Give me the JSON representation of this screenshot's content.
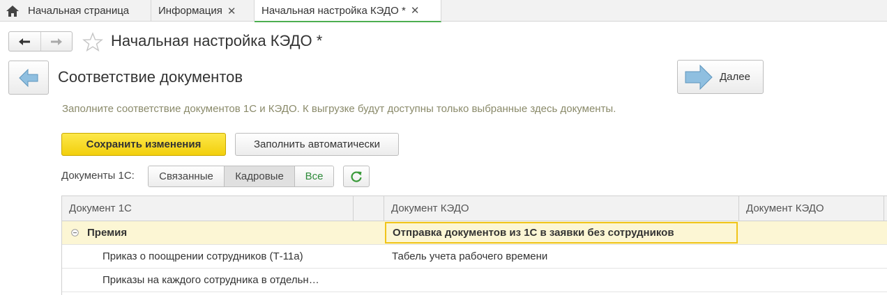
{
  "tabs": [
    {
      "label": "Начальная страница",
      "closable": false,
      "active": false
    },
    {
      "label": "Информация",
      "closable": true,
      "active": false
    },
    {
      "label": "Начальная настройка КЭДО *",
      "closable": true,
      "active": true
    }
  ],
  "window": {
    "title": "Начальная настройка КЭДО *"
  },
  "step": {
    "title": "Соответствие документов",
    "next_label": "Далее",
    "hint": "Заполните соответствие документов 1С и КЭДО. К выгрузке будут доступны только выбранные здесь документы."
  },
  "actions": {
    "save_label": "Сохранить изменения",
    "fill_label": "Заполнить автоматически"
  },
  "filter": {
    "label": "Документы 1С:",
    "options": [
      "Связанные",
      "Кадровые",
      "Все"
    ],
    "selected": "Все"
  },
  "table": {
    "columns": [
      "Документ 1С",
      "",
      "Документ КЭДО",
      "Документ КЭДО"
    ],
    "rows": [
      {
        "doc1c": "Премия",
        "kedo": "Отправка документов из 1С в заявки без сотрудников",
        "kedo2": "",
        "group": true
      },
      {
        "doc1c": "Приказ о поощрении сотрудников (Т-11а)",
        "kedo": "Табель учета рабочего времени",
        "kedo2": "",
        "group": false
      },
      {
        "doc1c": "Приказы на каждого сотрудника в отдельн…",
        "kedo": "",
        "kedo2": "",
        "group": false
      }
    ]
  },
  "colors": {
    "accent_yellow": "#f2cf0c",
    "active_tab_underline": "#4caf50",
    "selected_row": "#fcf6d4",
    "hint_text": "#8a8a6a"
  }
}
